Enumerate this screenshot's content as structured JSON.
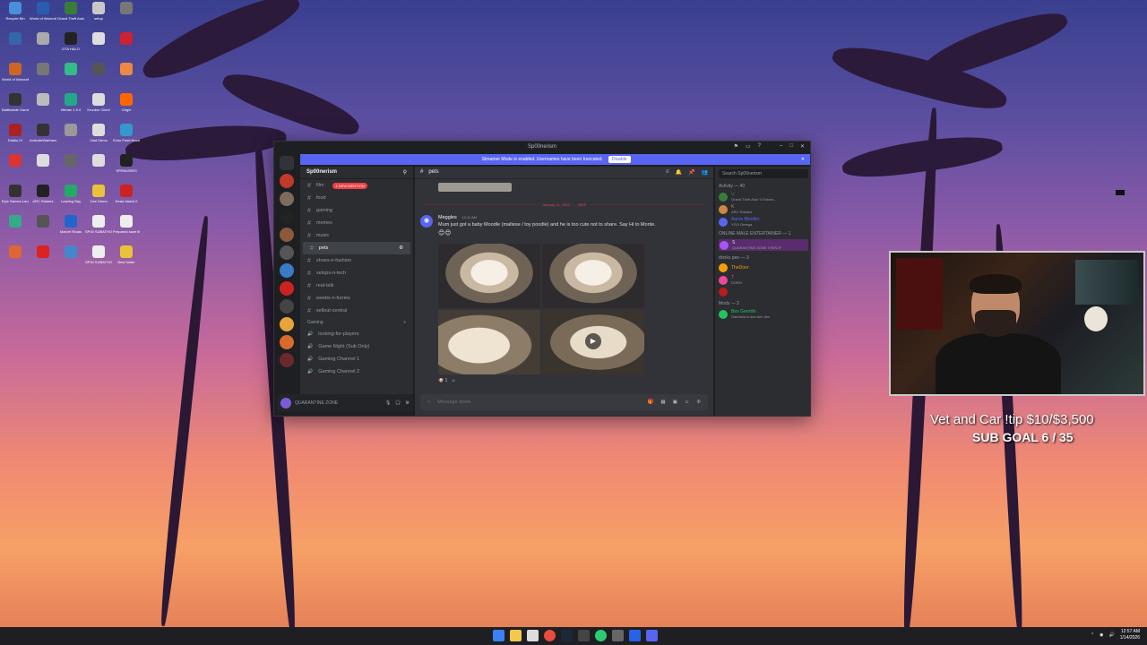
{
  "desktop": {
    "icons": [
      {
        "label": "Recycle Bin",
        "color": "#4a90d9"
      },
      {
        "label": "World of Warcraft",
        "color": "#2a5db0"
      },
      {
        "label": "Grand Theft Auto V Ex",
        "color": "#3a7d3a"
      },
      {
        "label": "setup",
        "color": "#c8c8c8"
      },
      {
        "label": "",
        "color": "#777"
      },
      {
        "label": "",
        "color": "#3366aa"
      },
      {
        "label": "",
        "color": "#aaa"
      },
      {
        "label": "GTA HALO",
        "color": "#222"
      },
      {
        "label": "",
        "color": "#ddd"
      },
      {
        "label": "",
        "color": "#c23"
      },
      {
        "label": "World of Warcraft",
        "color": "#c62"
      },
      {
        "label": "",
        "color": "#777"
      },
      {
        "label": "",
        "color": "#3b8"
      },
      {
        "label": "",
        "color": "#555"
      },
      {
        "label": "",
        "color": "#e84"
      },
      {
        "label": "Battlestate Games L",
        "color": "#333"
      },
      {
        "label": "",
        "color": "#bbb"
      },
      {
        "label": "Hitman 1.0.0",
        "color": "#2a8"
      },
      {
        "label": "Krunker Client",
        "color": "#ddd"
      },
      {
        "label": "Origin",
        "color": "#f60"
      },
      {
        "label": "Diablo IV",
        "color": "#a22"
      },
      {
        "label": "ActivateWarframe",
        "color": "#333"
      },
      {
        "label": "",
        "color": "#999"
      },
      {
        "label": "Vlad Demo",
        "color": "#ddd"
      },
      {
        "label": "Echo Point Nova",
        "color": "#39c"
      },
      {
        "label": "",
        "color": "#d33"
      },
      {
        "label": "",
        "color": "#ddd"
      },
      {
        "label": "",
        "color": "#666"
      },
      {
        "label": "",
        "color": "#ddd"
      },
      {
        "label": "SPRINGRES",
        "color": "#222"
      },
      {
        "label": "Epic Games Launcher",
        "color": "#333"
      },
      {
        "label": "ARC Raiders",
        "color": "#222"
      },
      {
        "label": "Loading Bay",
        "color": "#2a6"
      },
      {
        "label": "Vice Demo",
        "color": "#e8c33a"
      },
      {
        "label": "Dead Island 2",
        "color": "#c22"
      },
      {
        "label": "",
        "color": "#3a8"
      },
      {
        "label": "",
        "color": "#555"
      },
      {
        "label": "Marvel Rivals",
        "color": "#26c"
      },
      {
        "label": "SP00 SUBATHON",
        "color": "#eee"
      },
      {
        "label": "Prepared save file fo",
        "color": "#eee"
      },
      {
        "label": "",
        "color": "#d63"
      },
      {
        "label": "",
        "color": "#d22"
      },
      {
        "label": "",
        "color": "#48c"
      },
      {
        "label": "SP00 SUBATHON",
        "color": "#eee"
      },
      {
        "label": "New folder",
        "color": "#e8c33a"
      }
    ]
  },
  "discord": {
    "window_title": "Sp00nerism",
    "banner": {
      "text": "Streamer Mode is enabled. Usernames have been truncated.",
      "button": "Disable"
    },
    "server_name": "Sp00nerism",
    "channels": [
      {
        "name": "film",
        "prefix": "#",
        "mention": "1 NEW MENTION"
      },
      {
        "name": "food",
        "prefix": "#"
      },
      {
        "name": "gaming",
        "prefix": "#"
      },
      {
        "name": "memes",
        "prefix": "#"
      },
      {
        "name": "music",
        "prefix": "#"
      },
      {
        "name": "pets",
        "prefix": "#",
        "active": true
      },
      {
        "name": "shoes-n-fashion",
        "prefix": "#"
      },
      {
        "name": "setups-n-tech",
        "prefix": "#"
      },
      {
        "name": "real-talk",
        "prefix": "#"
      },
      {
        "name": "weebs-n-furries",
        "prefix": "#"
      },
      {
        "name": "sellout-central",
        "prefix": "#"
      }
    ],
    "category": "Gaming",
    "voice_channels": [
      "looking-for-players",
      "Game Night (Sub Only)",
      "Gaming Channel 1",
      "Gaming Channel 2"
    ],
    "user": {
      "status": "QUARANTINE ZONE"
    },
    "channel_header": "pets",
    "date_separator": "January 14, 2026",
    "new_tag": "NEW",
    "message": {
      "author": "Meggles",
      "time": "12:11 AM",
      "text": "Mum just got a baby Moodle (maltese / toy poodle) and he is too cute not to share. Say Hi to Monte.",
      "reaction_count": "1"
    },
    "composer_placeholder": "Message #pets",
    "members_search": "Search Sp00nerism",
    "activity_header": "Activity — 40",
    "members": [
      {
        "name": "U",
        "sub": "Grand Theft Auto V Enhan...",
        "color": "#3a7d3a"
      },
      {
        "name": "K",
        "sub": "ARC Raiders",
        "color": "#c84"
      },
      {
        "name": "Aaron Bleidler",
        "sub": "YGO Omega",
        "color": "#5865f2"
      }
    ],
    "role_1": "ONLINE MALE ENTERTAINER — 1",
    "role_1_member": {
      "name": "S",
      "sub": "QUARANTINE ZONE THEN IF",
      "color": "#a855f7"
    },
    "role_2": "drinks pee — 3",
    "role_2_members": [
      {
        "name": "TheDoor",
        "color": "#f59e0b"
      },
      {
        "name": "T",
        "sub": "DORO",
        "color": "#ec4899"
      },
      {
        "name": "",
        "color": "#b91c1c"
      }
    ],
    "role_3": "Mods — 2",
    "role_3_member": {
      "name": "Bex Gremlin",
      "sub": "Gabriella is dan dex dex",
      "color": "#22c55e"
    }
  },
  "stream": {
    "overlay_line1": "Vet and Car !tip $10/$3,500",
    "overlay_line2": "SUB GOAL 6 / 35"
  },
  "taskbar": {
    "time": "12:57 AM",
    "date": "1/14/2026"
  }
}
